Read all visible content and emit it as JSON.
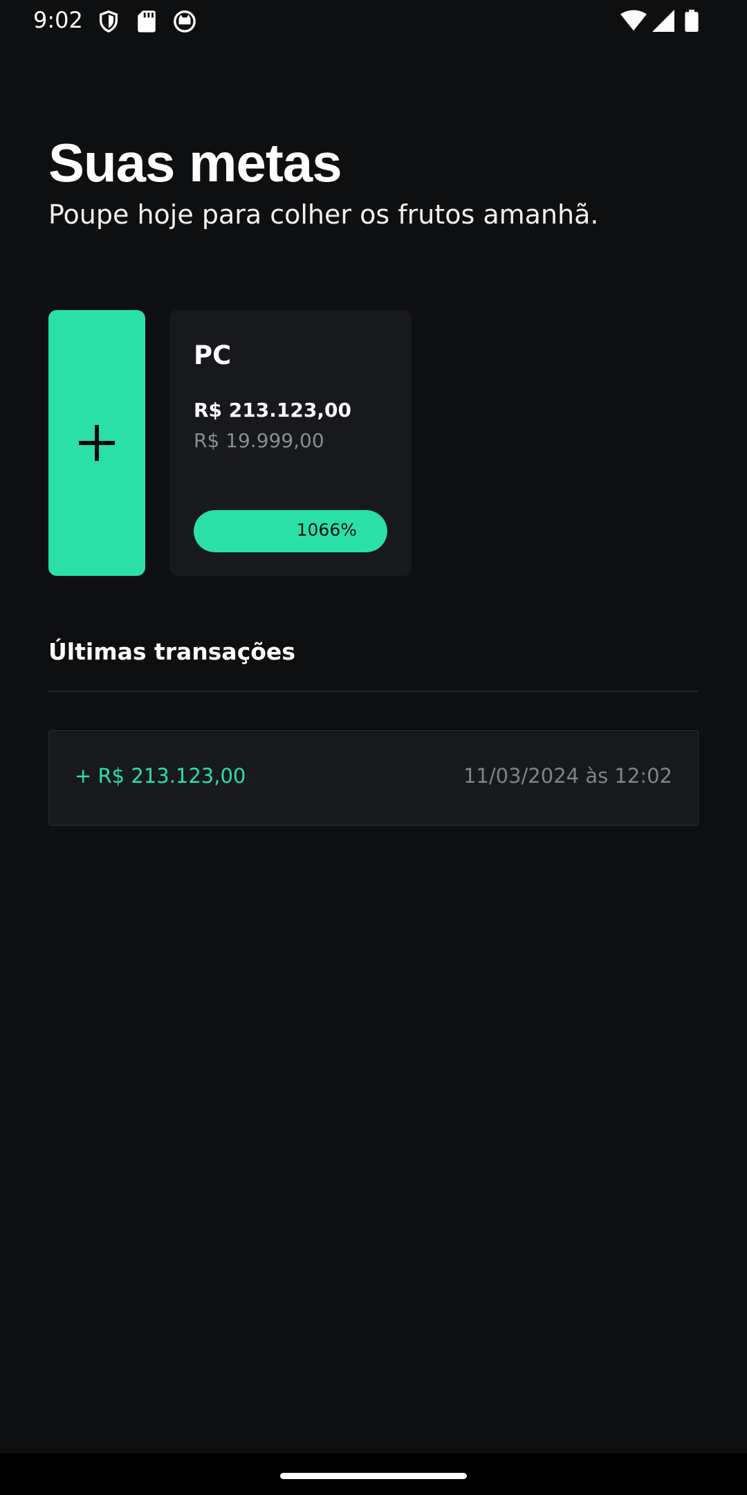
{
  "status_bar": {
    "time": "9:02",
    "left_icons": [
      "shield-icon",
      "sd-card-icon",
      "cat-face-icon"
    ],
    "right_icons": [
      "wifi-icon",
      "signal-icon",
      "battery-icon"
    ]
  },
  "header": {
    "title": "Suas metas",
    "subtitle": "Poupe hoje para colher os frutos amanhã."
  },
  "add_goal": {
    "icon": "plus-icon"
  },
  "goals": [
    {
      "name": "PC",
      "saved": "R$ 213.123,00",
      "target": "R$ 19.999,00",
      "progress_label": "1066%",
      "progress_fraction": 1.0
    }
  ],
  "transactions": {
    "title": "Últimas transações",
    "items": [
      {
        "amount": "+ R$ 213.123,00",
        "date": "11/03/2024 às 12:02"
      }
    ]
  },
  "colors": {
    "background": "#0e0f11",
    "card": "#18191c",
    "accent": "#2ae0a7",
    "muted_text": "#8a8d93"
  }
}
